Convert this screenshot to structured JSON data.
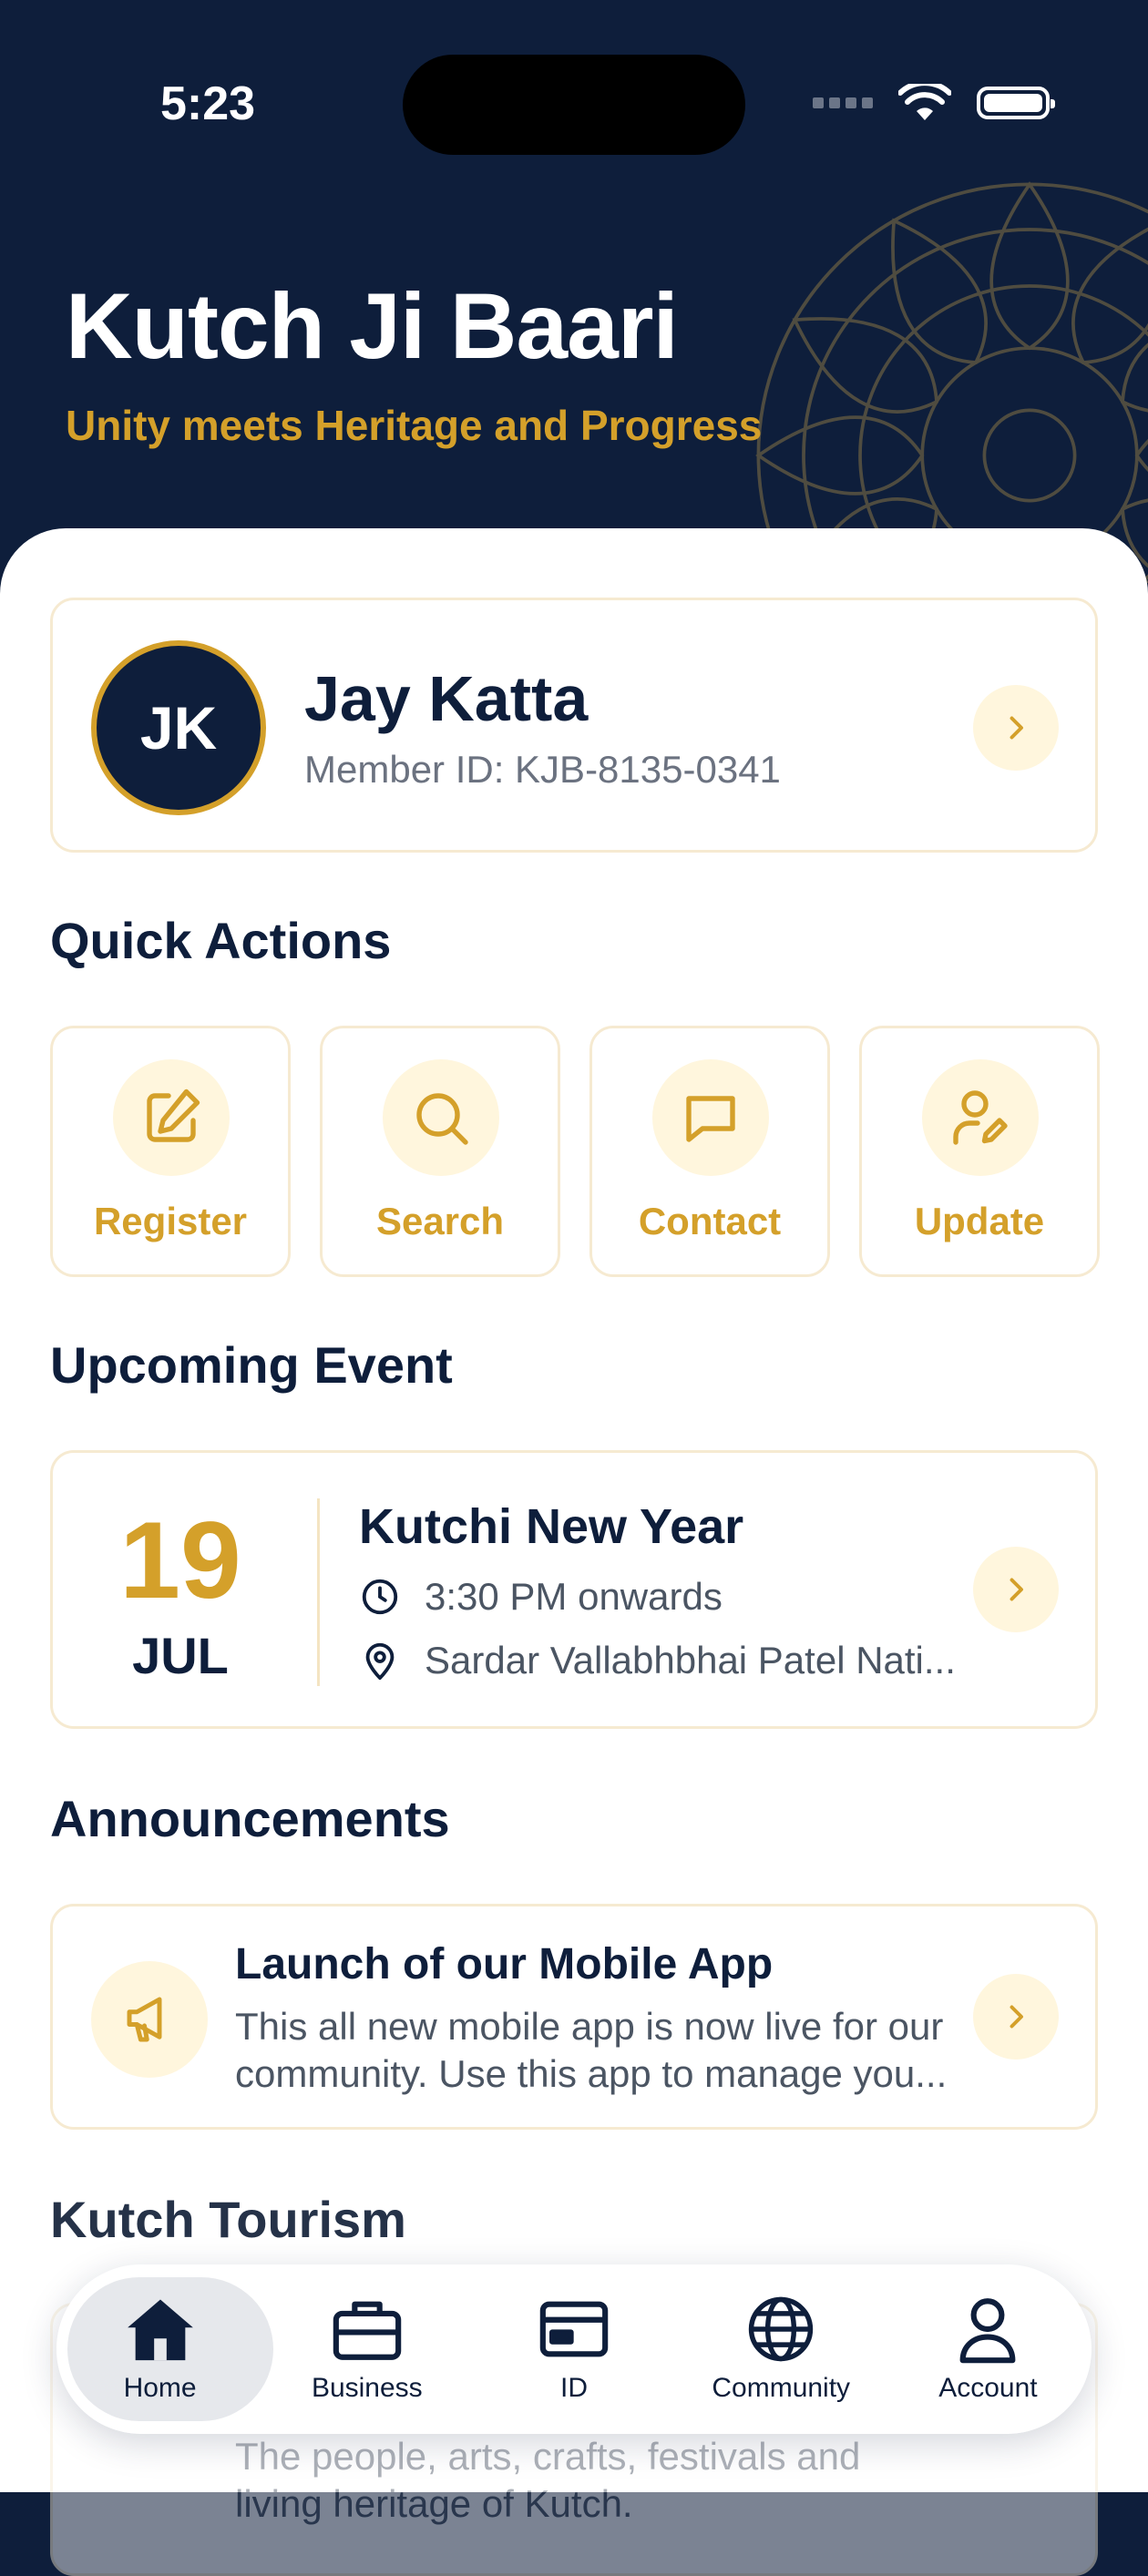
{
  "status_bar": {
    "time": "5:23"
  },
  "header": {
    "title": "Kutch Ji Baari",
    "subtitle": "Unity meets Heritage and Progress"
  },
  "profile": {
    "initials": "JK",
    "name": "Jay Katta",
    "member_id": "Member ID: KJB-8135-0341"
  },
  "quick_actions": {
    "title": "Quick Actions",
    "items": [
      {
        "label": "Register",
        "icon": "edit-icon"
      },
      {
        "label": "Search",
        "icon": "search-icon"
      },
      {
        "label": "Contact",
        "icon": "chat-icon"
      },
      {
        "label": "Update",
        "icon": "user-edit-icon"
      }
    ]
  },
  "upcoming_event": {
    "title": "Upcoming Event",
    "day": "19",
    "month": "JUL",
    "name": "Kutchi New Year",
    "time": "3:30 PM onwards",
    "location": "Sardar Vallabhbhai Patel Nati..."
  },
  "announcements": {
    "title": "Announcements",
    "item_title": "Launch of our Mobile App",
    "item_line1": "This all new mobile app is now live for our",
    "item_line2": "community. Use this app to manage you..."
  },
  "tourism": {
    "title": "Kutch Tourism",
    "line1": "The people, arts, crafts, festivals and",
    "line2": "living heritage of Kutch."
  },
  "tab_bar": {
    "tabs": [
      {
        "label": "Home",
        "icon": "home-icon",
        "active": true
      },
      {
        "label": "Business",
        "icon": "briefcase-icon"
      },
      {
        "label": "ID",
        "icon": "id-card-icon"
      },
      {
        "label": "Community",
        "icon": "globe-icon"
      },
      {
        "label": "Account",
        "icon": "user-icon"
      }
    ]
  },
  "colors": {
    "navy": "#0e1e3b",
    "gold": "#d4a02a",
    "gold_tint": "#fff6dd"
  }
}
